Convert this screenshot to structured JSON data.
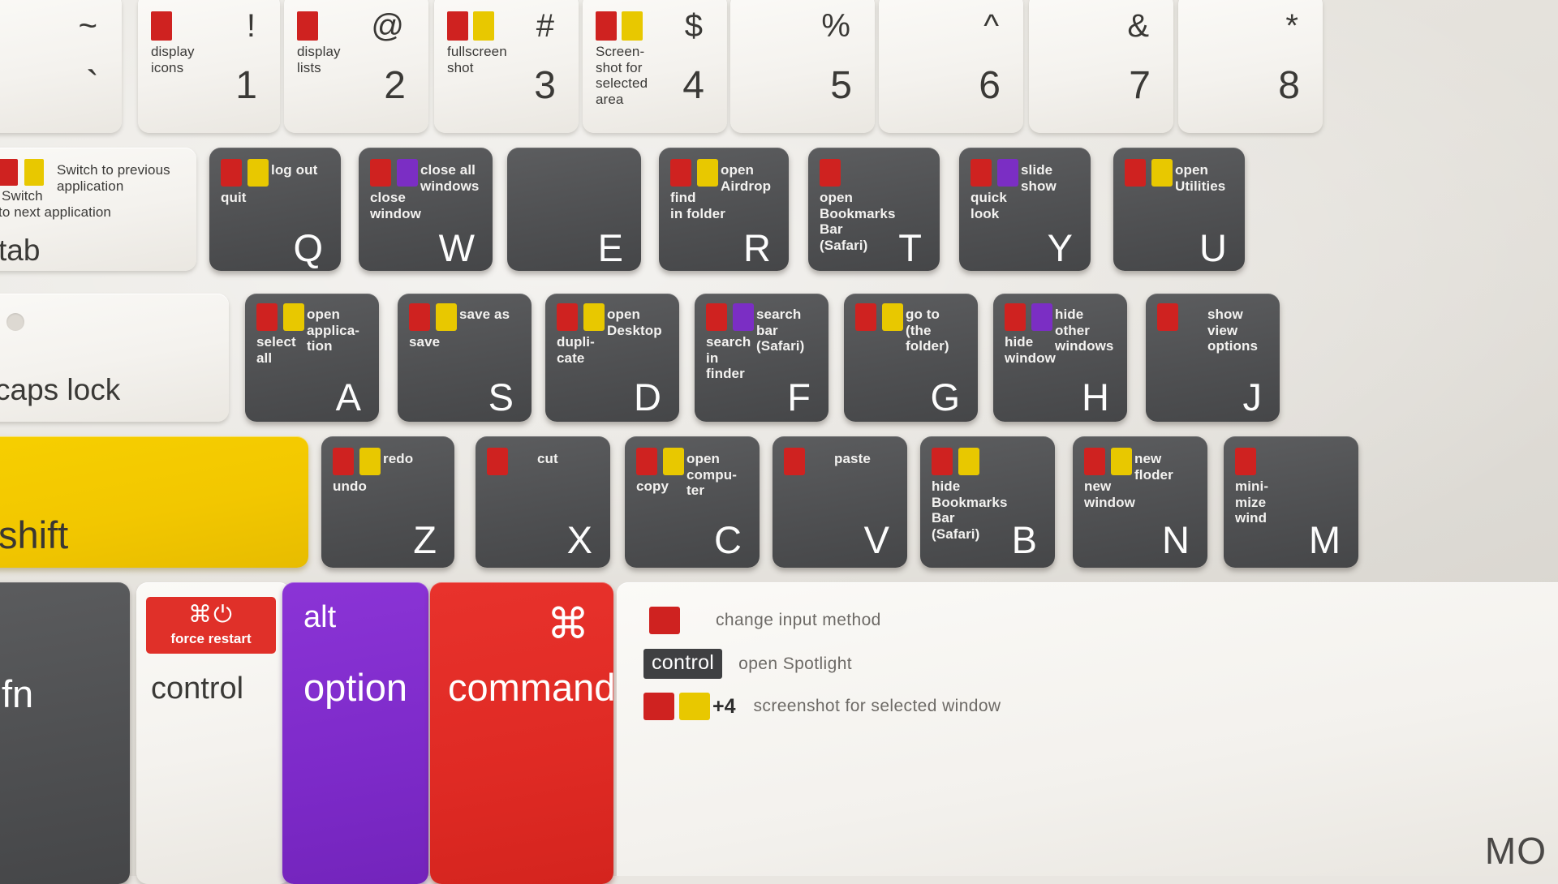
{
  "colors": {
    "red": "#cf2220",
    "yellow": "#e8c800",
    "purple": "#7b2ec4",
    "dark_key": "#4f5052",
    "white_key": "#f4f2ee",
    "shift_yellow": "#f2c700",
    "option_purple": "#7d2ac9",
    "command_red": "#df2a24"
  },
  "rows": {
    "number_row": [
      {
        "name": "tilde",
        "top_glyph": "~",
        "bottom_glyph": "`",
        "chips": [],
        "labels": []
      },
      {
        "name": "one",
        "top_glyph": "!",
        "bottom_glyph": "1",
        "chips": [
          "red"
        ],
        "labels": [
          "display",
          "icons"
        ]
      },
      {
        "name": "two",
        "top_glyph": "@",
        "bottom_glyph": "2",
        "chips": [
          "red"
        ],
        "labels": [
          "display",
          "lists"
        ]
      },
      {
        "name": "three",
        "top_glyph": "#",
        "bottom_glyph": "3",
        "chips": [
          "red",
          "yellow"
        ],
        "labels": [
          "fullscreen",
          "shot"
        ]
      },
      {
        "name": "four",
        "top_glyph": "$",
        "bottom_glyph": "4",
        "chips": [
          "red",
          "yellow"
        ],
        "labels": [
          "Screen-",
          "shot for",
          "selected",
          "area"
        ]
      },
      {
        "name": "five",
        "top_glyph": "%",
        "bottom_glyph": "5",
        "chips": [],
        "labels": []
      },
      {
        "name": "six",
        "top_glyph": "^",
        "bottom_glyph": "6",
        "chips": [],
        "labels": []
      },
      {
        "name": "seven",
        "top_glyph": "&",
        "bottom_glyph": "7",
        "chips": [],
        "labels": []
      },
      {
        "name": "eight",
        "top_glyph": "*",
        "bottom_glyph": "8",
        "chips": [],
        "labels": []
      }
    ],
    "tab_key": {
      "name": "tab",
      "glyph": "tab",
      "chips": [
        "red",
        "yellow"
      ],
      "primary": "Switch to next application",
      "primary_line1": "Switch",
      "primary_line2": "to next application",
      "secondary_line1": "Switch to previous",
      "secondary_line2": "application"
    },
    "qwerty_row": [
      {
        "name": "q",
        "glyph": "Q",
        "chips": [
          "red",
          "yellow"
        ],
        "primary": [
          "quit"
        ],
        "secondary": [
          "log out"
        ]
      },
      {
        "name": "w",
        "glyph": "W",
        "chips": [
          "red",
          "purple"
        ],
        "primary": [
          "close",
          "window"
        ],
        "secondary": [
          "close all",
          "windows"
        ]
      },
      {
        "name": "e",
        "glyph": "E",
        "chips": [],
        "primary": [],
        "secondary": []
      },
      {
        "name": "r",
        "glyph": "R",
        "chips": [
          "red",
          "yellow"
        ],
        "primary": [
          "find",
          "in folder"
        ],
        "secondary": [
          "open",
          "Airdrop"
        ]
      },
      {
        "name": "t",
        "glyph": "T",
        "chips": [
          "red"
        ],
        "primary": [
          "open",
          "Bookmarks",
          "Bar",
          "(Safari)"
        ],
        "secondary": []
      },
      {
        "name": "y",
        "glyph": "Y",
        "chips": [
          "red",
          "purple"
        ],
        "primary": [
          "quick",
          "look"
        ],
        "secondary": [
          "slide",
          "show"
        ]
      },
      {
        "name": "u",
        "glyph": "U",
        "chips": [
          "red",
          "yellow"
        ],
        "primary": [],
        "secondary": [
          "open",
          "Utilities"
        ]
      }
    ],
    "caps_key": {
      "name": "caps-lock",
      "glyph": "caps lock"
    },
    "home_row": [
      {
        "name": "a",
        "glyph": "A",
        "chips": [
          "red",
          "yellow"
        ],
        "primary": [
          "select",
          "all"
        ],
        "secondary": [
          "open",
          "applica-",
          "tion"
        ]
      },
      {
        "name": "s",
        "glyph": "S",
        "chips": [
          "red",
          "yellow"
        ],
        "primary": [
          "save"
        ],
        "secondary": [
          "save as"
        ]
      },
      {
        "name": "d",
        "glyph": "D",
        "chips": [
          "red",
          "yellow"
        ],
        "primary": [
          "dupli-",
          "cate"
        ],
        "secondary": [
          "open",
          "Desktop"
        ]
      },
      {
        "name": "f",
        "glyph": "F",
        "chips": [
          "red",
          "purple"
        ],
        "primary": [
          "search",
          "in",
          "finder"
        ],
        "secondary": [
          "search",
          "bar",
          "(Safari)"
        ]
      },
      {
        "name": "g",
        "glyph": "G",
        "chips": [
          "red",
          "yellow"
        ],
        "primary": [],
        "secondary": [
          "go to",
          "(the",
          "folder)"
        ]
      },
      {
        "name": "h",
        "glyph": "H",
        "chips": [
          "red",
          "purple"
        ],
        "primary": [
          "hide",
          "window"
        ],
        "secondary": [
          "hide",
          "other",
          "windows"
        ]
      },
      {
        "name": "j",
        "glyph": "J",
        "chips": [
          "red"
        ],
        "primary": [],
        "secondary": [
          "show",
          "view",
          "options"
        ]
      }
    ],
    "shift_key": {
      "name": "shift",
      "glyph": "shift"
    },
    "bottom_row": [
      {
        "name": "z",
        "glyph": "Z",
        "chips": [
          "red",
          "yellow"
        ],
        "primary": [
          "undo"
        ],
        "secondary": [
          "redo"
        ]
      },
      {
        "name": "x",
        "glyph": "X",
        "chips": [
          "red"
        ],
        "primary": [],
        "secondary": [
          "cut"
        ]
      },
      {
        "name": "c",
        "glyph": "C",
        "chips": [
          "red",
          "yellow"
        ],
        "primary": [
          "copy"
        ],
        "secondary": [
          "open",
          "compu-",
          "ter"
        ]
      },
      {
        "name": "v",
        "glyph": "V",
        "chips": [
          "red"
        ],
        "primary": [],
        "secondary": [
          "paste"
        ]
      },
      {
        "name": "b",
        "glyph": "B",
        "chips": [
          "red",
          "yellow"
        ],
        "primary": [
          "hide",
          "Bookmarks",
          "Bar",
          "(Safari)"
        ],
        "secondary": []
      },
      {
        "name": "n",
        "glyph": "N",
        "chips": [
          "red",
          "yellow"
        ],
        "primary": [
          "new",
          "window"
        ],
        "secondary": [
          "new",
          "floder"
        ]
      },
      {
        "name": "m",
        "glyph": "M",
        "chips": [
          "red"
        ],
        "primary": [
          "mini-",
          "mize",
          "wind"
        ],
        "secondary": []
      }
    ],
    "modifier_row": {
      "fn": {
        "name": "fn",
        "glyph": "fn"
      },
      "control": {
        "name": "control",
        "glyph": "control",
        "badge_symbol": "⌘⏻",
        "badge_text": "force restart"
      },
      "option": {
        "name": "option",
        "glyph": "option",
        "top_glyph": "alt"
      },
      "command": {
        "name": "command",
        "glyph": "command",
        "symbol": "⌘"
      }
    }
  },
  "legend_panel": {
    "rows": [
      {
        "key": "red-swatch",
        "text": "change input method"
      },
      {
        "key": "control-pill",
        "pill": "control",
        "text": "open Spotlight"
      },
      {
        "key": "red-yellow-plus4",
        "plus": "+4",
        "text": "screenshot for selected window"
      }
    ],
    "corner_text": "MO"
  }
}
